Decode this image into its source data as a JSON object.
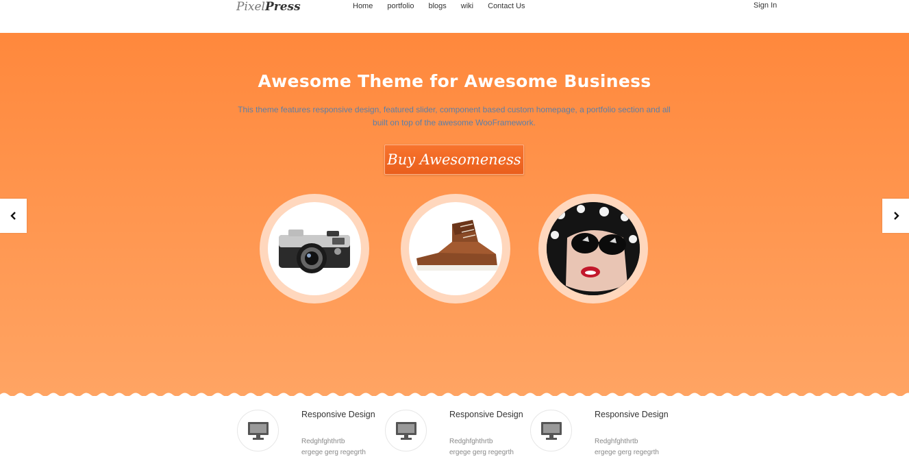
{
  "header": {
    "logo_part1": "Pixel",
    "logo_part2": "Press",
    "nav": [
      "Home",
      "portfolio",
      "blogs",
      "wiki",
      "Contact Us"
    ],
    "signin": "Sign In"
  },
  "hero": {
    "title": "Awesome Theme for Awesome Business",
    "description": "This theme features responsive design, featured slider, component based custom homepage, a portfolio section and all built on top of the awesome WooFramework.",
    "button": "Buy Awesomeness",
    "bg_top": "#ff883c",
    "bg_bottom": "#ffa463"
  },
  "features": [
    {
      "title": "Responsive Design",
      "line1": "Redghfghthrtb",
      "line2": "ergege gerg regegrth",
      "icon": "monitor-icon"
    },
    {
      "title": "Responsive Design",
      "line1": "Redghfghthrtb",
      "line2": "ergege gerg regegrth",
      "icon": "monitor-icon"
    },
    {
      "title": "Responsive Design",
      "line1": "Redghfghthrtb",
      "line2": "ergege gerg regegrth",
      "icon": "monitor-icon"
    }
  ]
}
